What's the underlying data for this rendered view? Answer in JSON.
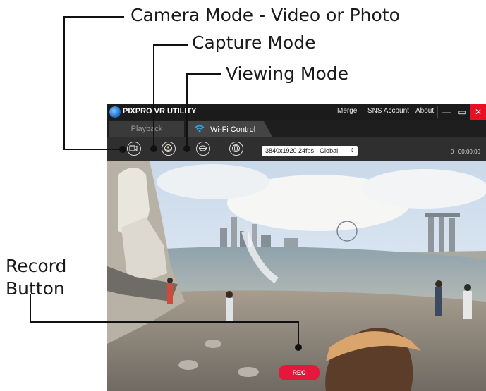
{
  "callouts": {
    "camera_mode": "Camera Mode - Video or Photo",
    "capture_mode": "Capture Mode",
    "viewing_mode": "Viewing Mode",
    "record_button_line1": "Record",
    "record_button_line2": "Button"
  },
  "window": {
    "title": "PIXPRO VR UTILITY",
    "menu": [
      "Merge",
      "SNS Account",
      "About"
    ],
    "controls": {
      "minimize": "—",
      "maximize": "▭",
      "close": "✕"
    },
    "close_color": "#e81123"
  },
  "tabs": [
    {
      "label": "Playback",
      "active": false
    },
    {
      "label": "Wi-Fi Control",
      "active": true,
      "icon": "wifi-icon"
    }
  ],
  "toolbar": {
    "camera_mode_icon": "video-camera-icon",
    "capture_mode_icon": "capture-mode-icon",
    "viewing_mode_icon": "dome-view-icon",
    "view_toggle_icon": "sphere-icon",
    "resolution_value": "3840x1920 24fps - Global",
    "counter": "0 | 00:00:00"
  },
  "record": {
    "label": "REC",
    "color": "#e4183d"
  }
}
